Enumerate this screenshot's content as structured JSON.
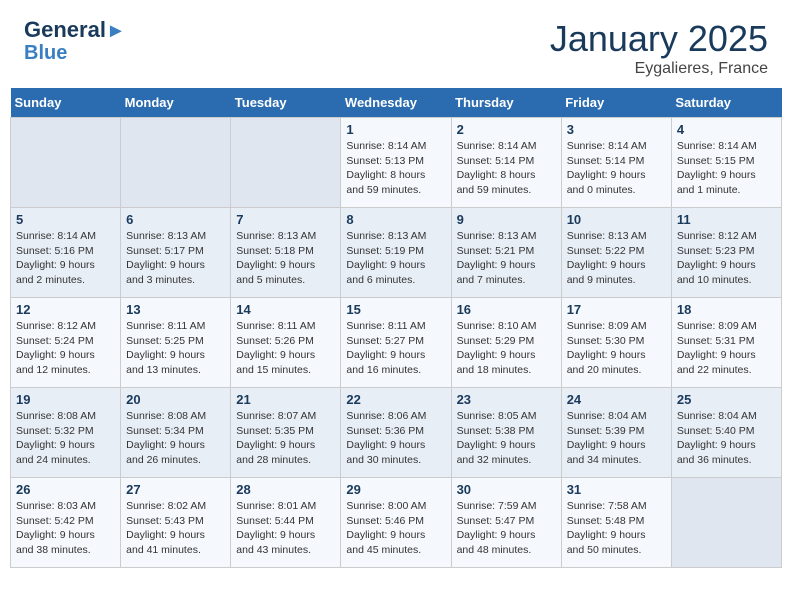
{
  "logo": {
    "line1": "General",
    "line2": "Blue",
    "bird": "▶"
  },
  "title": "January 2025",
  "subtitle": "Eygalieres, France",
  "days_of_week": [
    "Sunday",
    "Monday",
    "Tuesday",
    "Wednesday",
    "Thursday",
    "Friday",
    "Saturday"
  ],
  "weeks": [
    [
      {
        "day": "",
        "info": ""
      },
      {
        "day": "",
        "info": ""
      },
      {
        "day": "",
        "info": ""
      },
      {
        "day": "1",
        "info": "Sunrise: 8:14 AM\nSunset: 5:13 PM\nDaylight: 8 hours\nand 59 minutes."
      },
      {
        "day": "2",
        "info": "Sunrise: 8:14 AM\nSunset: 5:14 PM\nDaylight: 8 hours\nand 59 minutes."
      },
      {
        "day": "3",
        "info": "Sunrise: 8:14 AM\nSunset: 5:14 PM\nDaylight: 9 hours\nand 0 minutes."
      },
      {
        "day": "4",
        "info": "Sunrise: 8:14 AM\nSunset: 5:15 PM\nDaylight: 9 hours\nand 1 minute."
      }
    ],
    [
      {
        "day": "5",
        "info": "Sunrise: 8:14 AM\nSunset: 5:16 PM\nDaylight: 9 hours\nand 2 minutes."
      },
      {
        "day": "6",
        "info": "Sunrise: 8:13 AM\nSunset: 5:17 PM\nDaylight: 9 hours\nand 3 minutes."
      },
      {
        "day": "7",
        "info": "Sunrise: 8:13 AM\nSunset: 5:18 PM\nDaylight: 9 hours\nand 5 minutes."
      },
      {
        "day": "8",
        "info": "Sunrise: 8:13 AM\nSunset: 5:19 PM\nDaylight: 9 hours\nand 6 minutes."
      },
      {
        "day": "9",
        "info": "Sunrise: 8:13 AM\nSunset: 5:21 PM\nDaylight: 9 hours\nand 7 minutes."
      },
      {
        "day": "10",
        "info": "Sunrise: 8:13 AM\nSunset: 5:22 PM\nDaylight: 9 hours\nand 9 minutes."
      },
      {
        "day": "11",
        "info": "Sunrise: 8:12 AM\nSunset: 5:23 PM\nDaylight: 9 hours\nand 10 minutes."
      }
    ],
    [
      {
        "day": "12",
        "info": "Sunrise: 8:12 AM\nSunset: 5:24 PM\nDaylight: 9 hours\nand 12 minutes."
      },
      {
        "day": "13",
        "info": "Sunrise: 8:11 AM\nSunset: 5:25 PM\nDaylight: 9 hours\nand 13 minutes."
      },
      {
        "day": "14",
        "info": "Sunrise: 8:11 AM\nSunset: 5:26 PM\nDaylight: 9 hours\nand 15 minutes."
      },
      {
        "day": "15",
        "info": "Sunrise: 8:11 AM\nSunset: 5:27 PM\nDaylight: 9 hours\nand 16 minutes."
      },
      {
        "day": "16",
        "info": "Sunrise: 8:10 AM\nSunset: 5:29 PM\nDaylight: 9 hours\nand 18 minutes."
      },
      {
        "day": "17",
        "info": "Sunrise: 8:09 AM\nSunset: 5:30 PM\nDaylight: 9 hours\nand 20 minutes."
      },
      {
        "day": "18",
        "info": "Sunrise: 8:09 AM\nSunset: 5:31 PM\nDaylight: 9 hours\nand 22 minutes."
      }
    ],
    [
      {
        "day": "19",
        "info": "Sunrise: 8:08 AM\nSunset: 5:32 PM\nDaylight: 9 hours\nand 24 minutes."
      },
      {
        "day": "20",
        "info": "Sunrise: 8:08 AM\nSunset: 5:34 PM\nDaylight: 9 hours\nand 26 minutes."
      },
      {
        "day": "21",
        "info": "Sunrise: 8:07 AM\nSunset: 5:35 PM\nDaylight: 9 hours\nand 28 minutes."
      },
      {
        "day": "22",
        "info": "Sunrise: 8:06 AM\nSunset: 5:36 PM\nDaylight: 9 hours\nand 30 minutes."
      },
      {
        "day": "23",
        "info": "Sunrise: 8:05 AM\nSunset: 5:38 PM\nDaylight: 9 hours\nand 32 minutes."
      },
      {
        "day": "24",
        "info": "Sunrise: 8:04 AM\nSunset: 5:39 PM\nDaylight: 9 hours\nand 34 minutes."
      },
      {
        "day": "25",
        "info": "Sunrise: 8:04 AM\nSunset: 5:40 PM\nDaylight: 9 hours\nand 36 minutes."
      }
    ],
    [
      {
        "day": "26",
        "info": "Sunrise: 8:03 AM\nSunset: 5:42 PM\nDaylight: 9 hours\nand 38 minutes."
      },
      {
        "day": "27",
        "info": "Sunrise: 8:02 AM\nSunset: 5:43 PM\nDaylight: 9 hours\nand 41 minutes."
      },
      {
        "day": "28",
        "info": "Sunrise: 8:01 AM\nSunset: 5:44 PM\nDaylight: 9 hours\nand 43 minutes."
      },
      {
        "day": "29",
        "info": "Sunrise: 8:00 AM\nSunset: 5:46 PM\nDaylight: 9 hours\nand 45 minutes."
      },
      {
        "day": "30",
        "info": "Sunrise: 7:59 AM\nSunset: 5:47 PM\nDaylight: 9 hours\nand 48 minutes."
      },
      {
        "day": "31",
        "info": "Sunrise: 7:58 AM\nSunset: 5:48 PM\nDaylight: 9 hours\nand 50 minutes."
      },
      {
        "day": "",
        "info": ""
      }
    ]
  ]
}
